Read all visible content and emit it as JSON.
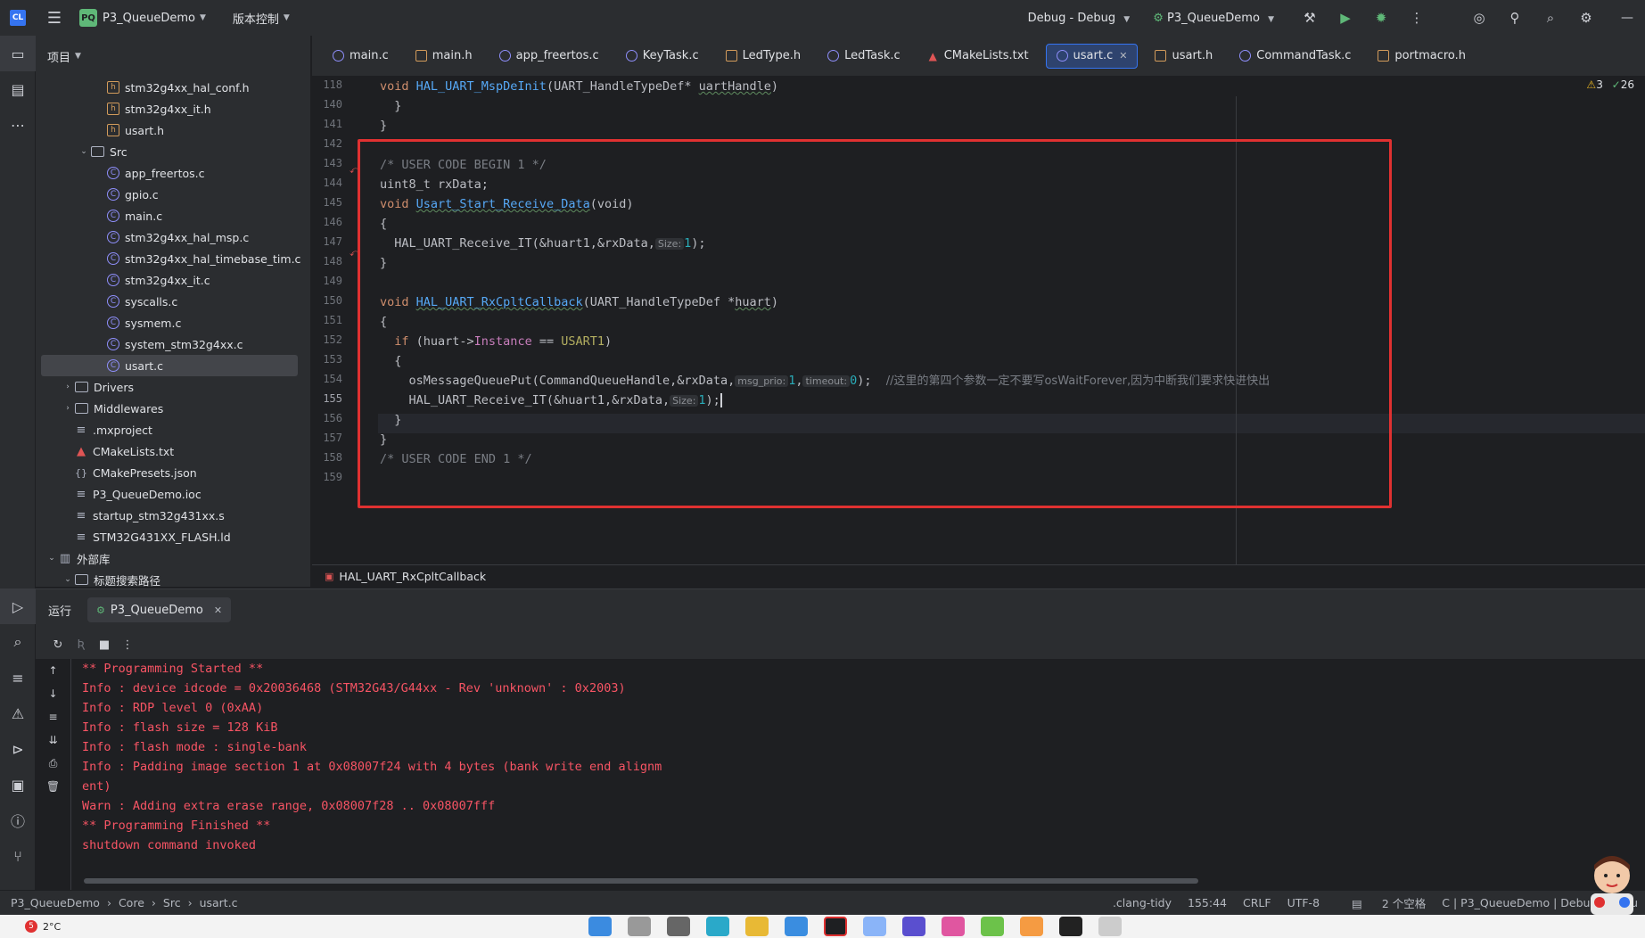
{
  "titlebar": {
    "project_badge": "PQ",
    "project_name": "P3_QueueDemo",
    "vcs_label": "版本控制",
    "run_config": "Debug - Debug",
    "target": "P3_QueueDemo",
    "minimize": "—"
  },
  "project_panel": {
    "title": "项目",
    "tree": [
      {
        "label": "stm32g4xx_hal_conf.h",
        "type": "h",
        "indent": 3
      },
      {
        "label": "stm32g4xx_it.h",
        "type": "h",
        "indent": 3
      },
      {
        "label": "usart.h",
        "type": "h",
        "indent": 3
      },
      {
        "label": "Src",
        "type": "folder",
        "indent": 2,
        "expanded": true
      },
      {
        "label": "app_freertos.c",
        "type": "c",
        "indent": 3
      },
      {
        "label": "gpio.c",
        "type": "c",
        "indent": 3
      },
      {
        "label": "main.c",
        "type": "c",
        "indent": 3
      },
      {
        "label": "stm32g4xx_hal_msp.c",
        "type": "c",
        "indent": 3
      },
      {
        "label": "stm32g4xx_hal_timebase_tim.c",
        "type": "c",
        "indent": 3
      },
      {
        "label": "stm32g4xx_it.c",
        "type": "c",
        "indent": 3
      },
      {
        "label": "syscalls.c",
        "type": "c",
        "indent": 3
      },
      {
        "label": "sysmem.c",
        "type": "c",
        "indent": 3
      },
      {
        "label": "system_stm32g4xx.c",
        "type": "c",
        "indent": 3
      },
      {
        "label": "usart.c",
        "type": "c",
        "indent": 3,
        "selected": true
      },
      {
        "label": "Drivers",
        "type": "folder",
        "indent": 1,
        "expanded": false
      },
      {
        "label": "Middlewares",
        "type": "folder",
        "indent": 1,
        "expanded": false
      },
      {
        "label": ".mxproject",
        "type": "txt",
        "indent": 1
      },
      {
        "label": "CMakeLists.txt",
        "type": "cmake",
        "indent": 1
      },
      {
        "label": "CMakePresets.json",
        "type": "json",
        "indent": 1
      },
      {
        "label": "P3_QueueDemo.ioc",
        "type": "txt",
        "indent": 1
      },
      {
        "label": "startup_stm32g431xx.s",
        "type": "txt",
        "indent": 1
      },
      {
        "label": "STM32G431XX_FLASH.ld",
        "type": "txt",
        "indent": 1
      },
      {
        "label": "外部库",
        "type": "lib",
        "indent": 0,
        "expanded": true
      },
      {
        "label": "标题搜索路径",
        "type": "folder",
        "indent": 1,
        "expanded": true
      }
    ]
  },
  "editor": {
    "tabs": [
      {
        "label": "main.c",
        "type": "c"
      },
      {
        "label": "main.h",
        "type": "h"
      },
      {
        "label": "app_freertos.c",
        "type": "c"
      },
      {
        "label": "KeyTask.c",
        "type": "c"
      },
      {
        "label": "LedType.h",
        "type": "h"
      },
      {
        "label": "LedTask.c",
        "type": "c"
      },
      {
        "label": "CMakeLists.txt",
        "type": "cmake"
      },
      {
        "label": "usart.c",
        "type": "c",
        "active": true
      },
      {
        "label": "usart.h",
        "type": "h"
      },
      {
        "label": "CommandTask.c",
        "type": "c"
      },
      {
        "label": "portmacro.h",
        "type": "h"
      }
    ],
    "warnings": "3",
    "checks": "26",
    "line_numbers": [
      "118",
      "140",
      "141",
      "142",
      "143",
      "144",
      "145",
      "146",
      "147",
      "148",
      "149",
      "150",
      "151",
      "152",
      "153",
      "154",
      "155",
      "156",
      "157",
      "158",
      "159"
    ],
    "sticky_line": "void HAL_UART_MspDeInit(UART_HandleTypeDef* uartHandle)",
    "code": {
      "l140": "  }",
      "l141": "}",
      "l143": "/* USER CODE BEGIN 1 */",
      "l144": "uint8_t rxData;",
      "l145_kw": "void ",
      "l145_fn": "Usart_Start_Receive_Data",
      "l145_rest": "(void)",
      "l146": "{",
      "l147_pre": "  HAL_UART_Receive_IT(&huart1,&rxData,",
      "l147_hint": "Size:",
      "l147_num": "1",
      "l147_post": ");",
      "l148": "}",
      "l150_kw": "void ",
      "l150_fn": "HAL_UART_RxCpltCallback",
      "l150_rest": "(UART_HandleTypeDef *",
      "l150_param": "huart",
      "l150_end": ")",
      "l151": "{",
      "l152_kw": "  if ",
      "l152_a": "(huart->",
      "l152_field": "Instance",
      "l152_b": " == ",
      "l152_macro": "USART1",
      "l152_c": ")",
      "l153": "  {",
      "l154_pre": "    osMessageQueuePut(CommandQueueHandle,&rxData,",
      "l154_hint1": "msg_prio:",
      "l154_num1": "1",
      "l154_sep": ",",
      "l154_hint2": "timeout:",
      "l154_num2": "0",
      "l154_post": ");  ",
      "l154_comment": "//这里的第四个参数一定不要写osWaitForever,因为中断我们要求快进快出",
      "l155_pre": "    HAL_UART_Receive_IT(&huart1,&rxData,",
      "l155_hint": "Size:",
      "l155_num": "1",
      "l155_post": ");",
      "l156": "  }",
      "l157": "}",
      "l158": "/* USER CODE END 1 */"
    },
    "breadcrumb_fn": "HAL_UART_RxCpltCallback"
  },
  "run_panel": {
    "title": "运行",
    "tab": "P3_QueueDemo",
    "console": [
      "** Programming Started **",
      "Info : device idcode = 0x20036468 (STM32G43/G44xx - Rev 'unknown' : 0x2003)",
      "Info : RDP level 0 (0xAA)",
      "Info : flash size = 128 KiB",
      "Info : flash mode : single-bank",
      "Info : Padding image section 1 at 0x08007f24 with 4 bytes (bank write end alignm",
      "ent)",
      "Warn : Adding extra erase range, 0x08007f28 .. 0x08007fff",
      "** Programming Finished **",
      "shutdown command invoked"
    ]
  },
  "statusbar": {
    "crumbs": [
      "P3_QueueDemo",
      "Core",
      "Src",
      "usart.c"
    ],
    "linter": ".clang-tidy",
    "position": "155:44",
    "line_sep": "CRLF",
    "encoding": "UTF-8",
    "indent": "2 个空格",
    "context": "C | P3_QueueDemo | Debug - Debu"
  },
  "taskbar": {
    "badge": "5",
    "temp": "2°C"
  }
}
